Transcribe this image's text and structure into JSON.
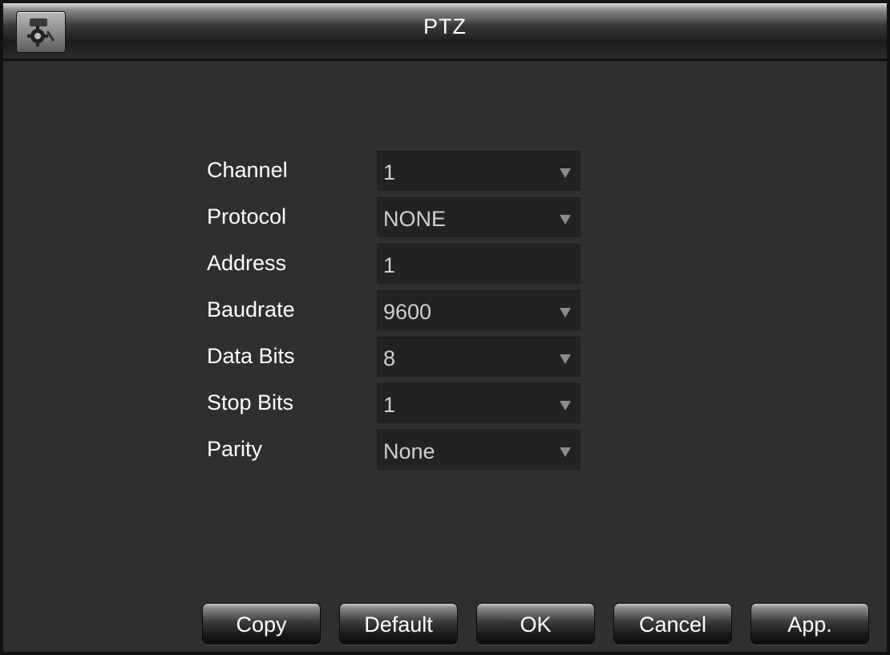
{
  "window": {
    "title": "PTZ"
  },
  "form": {
    "rows": [
      {
        "label": "Channel",
        "value": "1",
        "type": "dropdown"
      },
      {
        "label": "Protocol",
        "value": "NONE",
        "type": "dropdown"
      },
      {
        "label": "Address",
        "value": "1",
        "type": "input"
      },
      {
        "label": "Baudrate",
        "value": "9600",
        "type": "dropdown"
      },
      {
        "label": "Data Bits",
        "value": "8",
        "type": "dropdown"
      },
      {
        "label": "Stop Bits",
        "value": "1",
        "type": "dropdown"
      },
      {
        "label": "Parity",
        "value": "None",
        "type": "dropdown"
      }
    ]
  },
  "buttons": {
    "copy": "Copy",
    "default": "Default",
    "ok": "OK",
    "cancel": "Cancel",
    "apply": "App."
  },
  "icons": {
    "app_icon": "settings-gear-icon",
    "dropdown": "triangle-down-icon"
  },
  "colors": {
    "background": "#2f2f2f",
    "field": "#222222",
    "text": "#ffffff",
    "field_text": "#cfcfcf"
  }
}
